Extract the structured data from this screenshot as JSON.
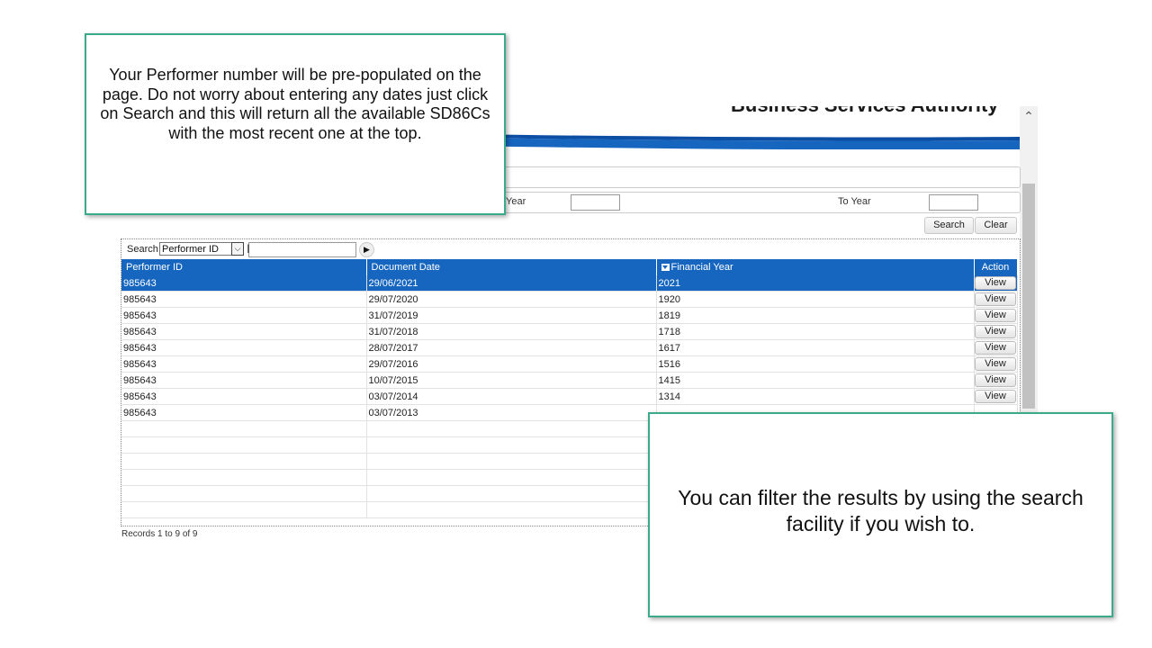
{
  "app": {
    "brand_title": "Business Services Authority",
    "colors": {
      "accent": "#1666bf",
      "callout_border": "#3aaa8a"
    }
  },
  "filters": {
    "from_year_label": "Year",
    "from_year_value": "",
    "to_year_label": "To Year",
    "to_year_value": "",
    "search_button": "Search",
    "clear_button": "Clear"
  },
  "grid_search": {
    "label": "Search",
    "selected_field": "Performer ID",
    "dropdown_icon": "chevron-down-icon",
    "text_value": "",
    "go_icon": "play-arrow-icon"
  },
  "table": {
    "headers": {
      "performer_id": "Performer ID",
      "document_date": "Document Date",
      "financial_year": "Financial Year",
      "action": "Action"
    },
    "sort_column": "financial_year",
    "rows": [
      {
        "performer_id": "985643",
        "document_date": "29/06/2021",
        "financial_year": "2021",
        "action": "View"
      },
      {
        "performer_id": "985643",
        "document_date": "29/07/2020",
        "financial_year": "1920",
        "action": "View"
      },
      {
        "performer_id": "985643",
        "document_date": "31/07/2019",
        "financial_year": "1819",
        "action": "View"
      },
      {
        "performer_id": "985643",
        "document_date": "31/07/2018",
        "financial_year": "1718",
        "action": "View"
      },
      {
        "performer_id": "985643",
        "document_date": "28/07/2017",
        "financial_year": "1617",
        "action": "View"
      },
      {
        "performer_id": "985643",
        "document_date": "29/07/2016",
        "financial_year": "1516",
        "action": "View"
      },
      {
        "performer_id": "985643",
        "document_date": "10/07/2015",
        "financial_year": "1415",
        "action": "View"
      },
      {
        "performer_id": "985643",
        "document_date": "03/07/2014",
        "financial_year": "1314",
        "action": "View"
      },
      {
        "performer_id": "985643",
        "document_date": "03/07/2013",
        "financial_year": "",
        "action": ""
      }
    ],
    "selected_row": 0,
    "records_text": "Records 1 to 9 of 9"
  },
  "callouts": {
    "top": "Your Performer number will be pre-populated on the page.  Do not worry about entering any dates just click on Search and this will return all the available SD86Cs with the most recent one at the top.",
    "bottom": "You can filter the results by using the search facility if you wish to."
  }
}
